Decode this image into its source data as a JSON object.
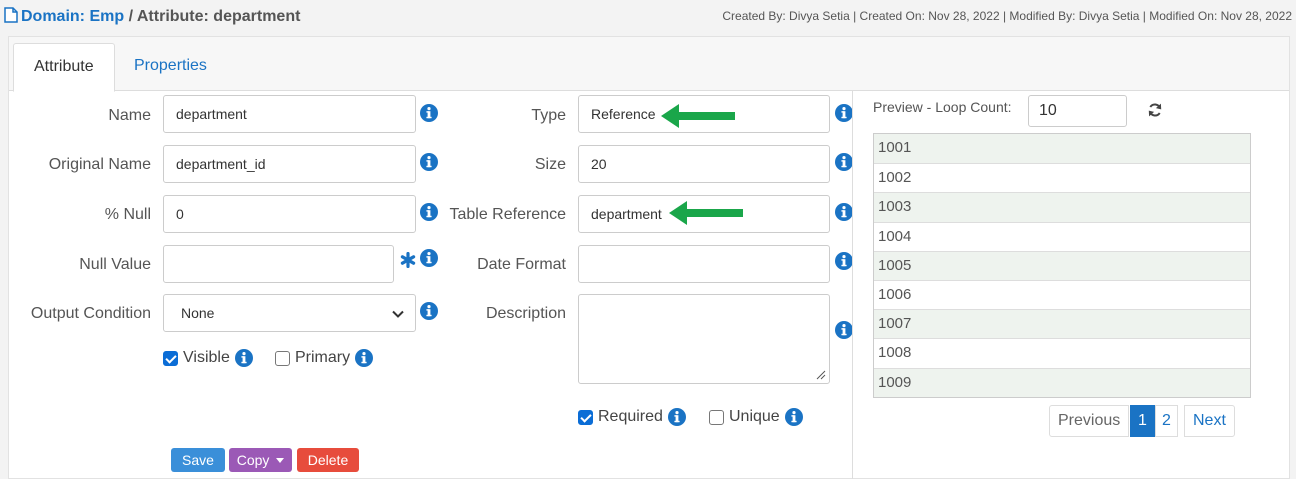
{
  "header": {
    "domain": "Domain: Emp",
    "separator": " / ",
    "attribute": "Attribute: department",
    "meta": "Created By: Divya Setia | Created On: Nov 28, 2022 | Modified By: Divya Setia | Modified On: Nov 28, 2022"
  },
  "tabs": [
    {
      "label": "Attribute",
      "active": true
    },
    {
      "label": "Properties",
      "active": false
    }
  ],
  "form": {
    "name_label": "Name",
    "name_value": "department",
    "original_label": "Original Name",
    "original_value": "department_id",
    "null_label": "% Null",
    "null_value": "0",
    "nullvalue_label": "Null Value",
    "nullvalue_value": "",
    "output_label": "Output Condition",
    "output_value": "None",
    "visible_label": "Visible",
    "visible_checked": true,
    "primary_label": "Primary",
    "primary_checked": false,
    "type_label": "Type",
    "type_value": "Reference",
    "size_label": "Size",
    "size_value": "20",
    "tableref_label": "Table Reference",
    "tableref_value": "department",
    "dateformat_label": "Date Format",
    "dateformat_value": "",
    "description_label": "Description",
    "description_value": "",
    "required_label": "Required",
    "required_checked": true,
    "unique_label": "Unique",
    "unique_checked": false
  },
  "buttons": {
    "save": "Save",
    "copy": "Copy",
    "delete": "Delete"
  },
  "preview": {
    "label": "Preview - Loop Count:",
    "loop_count": "10",
    "rows": [
      "1001",
      "1002",
      "1003",
      "1004",
      "1005",
      "1006",
      "1007",
      "1008",
      "1009"
    ]
  },
  "pagination": {
    "previous": "Previous",
    "pages": [
      "1",
      "2"
    ],
    "current": "1",
    "next": "Next"
  },
  "icons": {
    "document": "document-icon",
    "info": "info-icon",
    "required_marker": "asterisk-icon",
    "dropdown": "chevron-down-icon",
    "annotation": "green-arrow-icon",
    "refresh": "refresh-icon"
  },
  "colors": {
    "link": "#1a73c4",
    "save": "#3a8fd9",
    "copy": "#9b59b6",
    "delete": "#e74c3c",
    "annotation_arrow": "#1aa64a",
    "info": "#1a73c4"
  }
}
